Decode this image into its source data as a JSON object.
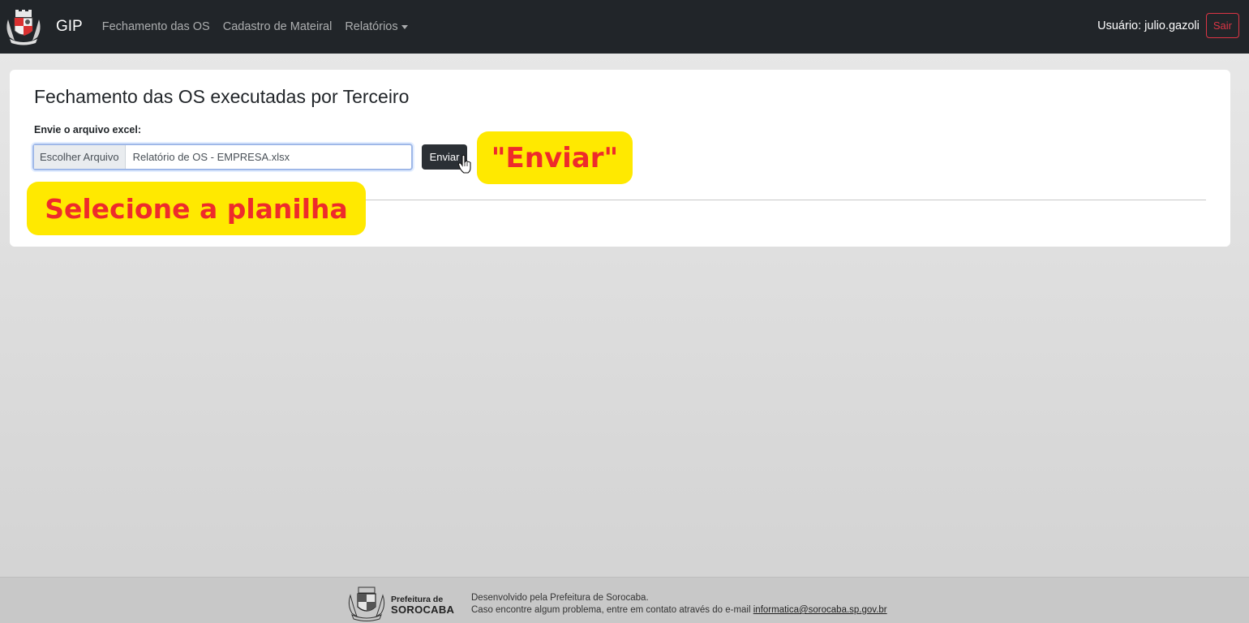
{
  "navbar": {
    "brand": "GIP",
    "links": [
      {
        "label": "Fechamento das OS"
      },
      {
        "label": "Cadastro de Mateiral"
      },
      {
        "label": "Relatórios"
      }
    ],
    "user": "Usuário: julio.gazoli",
    "logout": "Sair"
  },
  "card": {
    "title": "Fechamento das OS executadas por Terceiro",
    "label": "Envie o arquivo excel:",
    "file_button": "Escolher Arquivo",
    "file_name": "Relatório de OS - EMPRESA.xlsx",
    "submit": "Enviar"
  },
  "annotations": {
    "enviar": "\"Enviar\"",
    "selecione": "Selecione a planilha"
  },
  "footer": {
    "brand_line1": "Prefeitura de",
    "brand_line2": "SOROCABA",
    "line1": "Desenvolvido pela Prefeitura de Sorocaba.",
    "line2": "Caso encontre algum problema, entre em contato através do e-mail ",
    "email": "informatica@sorocaba.sp.gov.br"
  },
  "colors": {
    "navbar": "#212529",
    "danger": "#dc3545",
    "callout_bg": "#ffe900",
    "callout_text": "#ee2b2b"
  }
}
